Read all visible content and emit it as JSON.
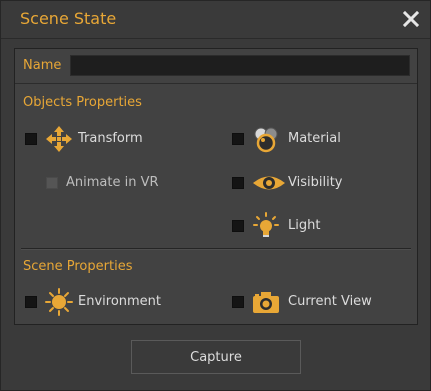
{
  "dialog": {
    "title": "Scene State",
    "close_icon": "close-icon"
  },
  "name_field": {
    "label": "Name",
    "value": ""
  },
  "objects_properties": {
    "title": "Objects Properties",
    "items": [
      {
        "label": "Transform",
        "icon": "transform-arrows-icon",
        "checked": false
      },
      {
        "label": "Animate in VR",
        "icon": "",
        "checked": false,
        "disabled": true
      },
      {
        "label": "Material",
        "icon": "material-spheres-icon",
        "checked": false
      },
      {
        "label": "Visibility",
        "icon": "eye-icon",
        "checked": false
      },
      {
        "label": "Light",
        "icon": "light-bulb-icon",
        "checked": false
      }
    ]
  },
  "scene_properties": {
    "title": "Scene Properties",
    "items": [
      {
        "label": "Environment",
        "icon": "sun-icon",
        "checked": false
      },
      {
        "label": "Current View",
        "icon": "camera-icon",
        "checked": false
      }
    ]
  },
  "footer": {
    "capture_label": "Capture"
  },
  "colors": {
    "accent": "#e8a736",
    "background": "#3a3a3a",
    "panel": "#424242",
    "text": "#dcdcdc"
  }
}
